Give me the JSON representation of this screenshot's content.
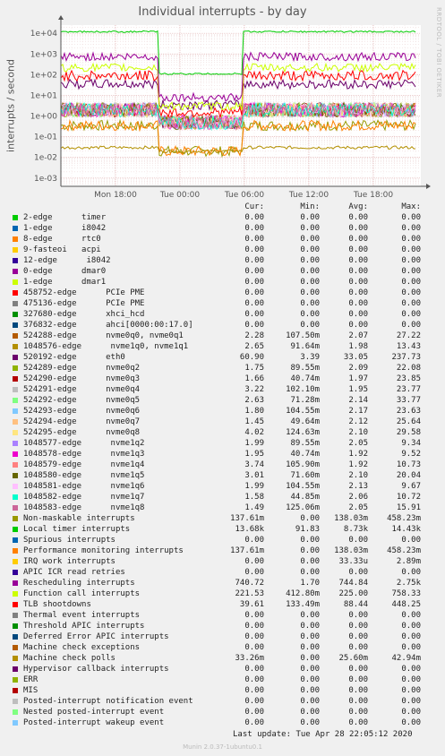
{
  "header": {
    "side_text": "RRDTOOL / TOBI OETIKER"
  },
  "footer": {
    "last_update": "Last update:  Tue Apr 28 22:05:12 2020",
    "munin_version": "Munin 2.0.37-1ubuntu0.1"
  },
  "legend_headers": {
    "cur": "Cur:",
    "min": "Min:",
    "avg": "Avg:",
    "max": "Max:"
  },
  "chart_data": {
    "type": "line",
    "title": "Individual interrupts - by day",
    "ylabel": "interrupts / second",
    "yscale": "log",
    "ylim": [
      0.0004,
      25000
    ],
    "y_ticks": [
      "1e-03",
      "1e-02",
      "1e-01",
      "1e+00",
      "1e+01",
      "1e+02",
      "1e+03",
      "1e+04"
    ],
    "x_ticks": [
      "Mon 18:00",
      "Tue 00:00",
      "Tue 06:00",
      "Tue 12:00",
      "Tue 18:00"
    ],
    "grid": true,
    "legend_position": "bottom",
    "series": [
      {
        "name": "2-edge      timer",
        "color": "#00cc00",
        "cur": "0.00",
        "min": "0.00",
        "avg": "0.00",
        "max": "0.00"
      },
      {
        "name": "1-edge      i8042",
        "color": "#0066b3",
        "cur": "0.00",
        "min": "0.00",
        "avg": "0.00",
        "max": "0.00"
      },
      {
        "name": "8-edge      rtc0",
        "color": "#ff8000",
        "cur": "0.00",
        "min": "0.00",
        "avg": "0.00",
        "max": "0.00"
      },
      {
        "name": "9-fasteoi   acpi",
        "color": "#ffcc00",
        "cur": "0.00",
        "min": "0.00",
        "avg": "0.00",
        "max": "0.00"
      },
      {
        "name": "12-edge      i8042",
        "color": "#330099",
        "cur": "0.00",
        "min": "0.00",
        "avg": "0.00",
        "max": "0.00"
      },
      {
        "name": "0-edge      dmar0",
        "color": "#990099",
        "cur": "0.00",
        "min": "0.00",
        "avg": "0.00",
        "max": "0.00"
      },
      {
        "name": "1-edge      dmar1",
        "color": "#ccff00",
        "cur": "0.00",
        "min": "0.00",
        "avg": "0.00",
        "max": "0.00"
      },
      {
        "name": "458752-edge      PCIe PME",
        "color": "#ff0000",
        "cur": "0.00",
        "min": "0.00",
        "avg": "0.00",
        "max": "0.00"
      },
      {
        "name": "475136-edge      PCIe PME",
        "color": "#808080",
        "cur": "0.00",
        "min": "0.00",
        "avg": "0.00",
        "max": "0.00"
      },
      {
        "name": "327680-edge      xhci_hcd",
        "color": "#008f00",
        "cur": "0.00",
        "min": "0.00",
        "avg": "0.00",
        "max": "0.00"
      },
      {
        "name": "376832-edge      ahci[0000:00:17.0]",
        "color": "#00487d",
        "cur": "0.00",
        "min": "0.00",
        "avg": "0.00",
        "max": "0.00"
      },
      {
        "name": "524288-edge      nvme0q0, nvme0q1",
        "color": "#b35a00",
        "cur": "2.28",
        "min": "107.50m",
        "avg": "2.07",
        "max": "27.22"
      },
      {
        "name": "1048576-edge      nvme1q0, nvme1q1",
        "color": "#b38f00",
        "cur": "2.65",
        "min": "91.64m",
        "avg": "1.98",
        "max": "13.43"
      },
      {
        "name": "520192-edge      eth0",
        "color": "#6b006b",
        "cur": "60.90",
        "min": "3.39",
        "avg": "33.05",
        "max": "237.73"
      },
      {
        "name": "524289-edge      nvme0q2",
        "color": "#8fb300",
        "cur": "1.75",
        "min": "89.55m",
        "avg": "2.09",
        "max": "22.08"
      },
      {
        "name": "524290-edge      nvme0q3",
        "color": "#b30000",
        "cur": "1.66",
        "min": "40.74m",
        "avg": "1.97",
        "max": "23.85"
      },
      {
        "name": "524291-edge      nvme0q4",
        "color": "#bebebe",
        "cur": "3.22",
        "min": "102.10m",
        "avg": "1.95",
        "max": "23.77"
      },
      {
        "name": "524292-edge      nvme0q5",
        "color": "#80ff80",
        "cur": "2.63",
        "min": "71.28m",
        "avg": "2.14",
        "max": "33.77"
      },
      {
        "name": "524293-edge      nvme0q6",
        "color": "#80c9ff",
        "cur": "1.80",
        "min": "104.55m",
        "avg": "2.17",
        "max": "23.63"
      },
      {
        "name": "524294-edge      nvme0q7",
        "color": "#ffc080",
        "cur": "1.45",
        "min": "49.64m",
        "avg": "2.12",
        "max": "25.64"
      },
      {
        "name": "524295-edge      nvme0q8",
        "color": "#ffe680",
        "cur": "4.02",
        "min": "124.63m",
        "avg": "2.10",
        "max": "29.58"
      },
      {
        "name": "1048577-edge      nvme1q2",
        "color": "#aa80ff",
        "cur": "1.99",
        "min": "89.55m",
        "avg": "2.05",
        "max": "9.34"
      },
      {
        "name": "1048578-edge      nvme1q3",
        "color": "#ee00cc",
        "cur": "1.95",
        "min": "40.74m",
        "avg": "1.92",
        "max": "9.52"
      },
      {
        "name": "1048579-edge      nvme1q4",
        "color": "#ff8080",
        "cur": "3.74",
        "min": "105.90m",
        "avg": "1.92",
        "max": "10.73"
      },
      {
        "name": "1048580-edge      nvme1q5",
        "color": "#666600",
        "cur": "3.01",
        "min": "71.60m",
        "avg": "2.10",
        "max": "20.04"
      },
      {
        "name": "1048581-edge      nvme1q6",
        "color": "#ffbfff",
        "cur": "1.99",
        "min": "104.55m",
        "avg": "2.13",
        "max": "9.67"
      },
      {
        "name": "1048582-edge      nvme1q7",
        "color": "#00ffcc",
        "cur": "1.58",
        "min": "44.85m",
        "avg": "2.06",
        "max": "10.72"
      },
      {
        "name": "1048583-edge      nvme1q8",
        "color": "#cc6699",
        "cur": "1.49",
        "min": "125.06m",
        "avg": "2.05",
        "max": "15.91"
      },
      {
        "name": "Non-maskable interrupts",
        "color": "#999900",
        "cur": "137.61m",
        "min": "0.00",
        "avg": "138.03m",
        "max": "458.23m"
      },
      {
        "name": "Local timer interrupts",
        "color": "#00cc00",
        "cur": "13.68k",
        "min": "91.83",
        "avg": "8.73k",
        "max": "14.43k"
      },
      {
        "name": "Spurious interrupts",
        "color": "#0066b3",
        "cur": "0.00",
        "min": "0.00",
        "avg": "0.00",
        "max": "0.00"
      },
      {
        "name": "Performance monitoring interrupts",
        "color": "#ff8000",
        "cur": "137.61m",
        "min": "0.00",
        "avg": "138.03m",
        "max": "458.23m"
      },
      {
        "name": "IRQ work interrupts",
        "color": "#ffcc00",
        "cur": "0.00",
        "min": "0.00",
        "avg": "33.33u",
        "max": "2.89m"
      },
      {
        "name": "APIC ICR read retries",
        "color": "#330099",
        "cur": "0.00",
        "min": "0.00",
        "avg": "0.00",
        "max": "0.00"
      },
      {
        "name": "Rescheduling interrupts",
        "color": "#990099",
        "cur": "740.72",
        "min": "1.70",
        "avg": "744.84",
        "max": "2.75k"
      },
      {
        "name": "Function call interrupts",
        "color": "#ccff00",
        "cur": "221.53",
        "min": "412.80m",
        "avg": "225.00",
        "max": "758.33"
      },
      {
        "name": "TLB shootdowns",
        "color": "#ff0000",
        "cur": "39.61",
        "min": "133.49m",
        "avg": "88.44",
        "max": "448.25"
      },
      {
        "name": "Thermal event interrupts",
        "color": "#808080",
        "cur": "0.00",
        "min": "0.00",
        "avg": "0.00",
        "max": "0.00"
      },
      {
        "name": "Threshold APIC interrupts",
        "color": "#008f00",
        "cur": "0.00",
        "min": "0.00",
        "avg": "0.00",
        "max": "0.00"
      },
      {
        "name": "Deferred Error APIC interrupts",
        "color": "#00487d",
        "cur": "0.00",
        "min": "0.00",
        "avg": "0.00",
        "max": "0.00"
      },
      {
        "name": "Machine check exceptions",
        "color": "#b35a00",
        "cur": "0.00",
        "min": "0.00",
        "avg": "0.00",
        "max": "0.00"
      },
      {
        "name": "Machine check polls",
        "color": "#b38f00",
        "cur": "33.26m",
        "min": "0.00",
        "avg": "25.60m",
        "max": "42.94m"
      },
      {
        "name": "Hypervisor callback interrupts",
        "color": "#6b006b",
        "cur": "0.00",
        "min": "0.00",
        "avg": "0.00",
        "max": "0.00"
      },
      {
        "name": "ERR",
        "color": "#8fb300",
        "cur": "0.00",
        "min": "0.00",
        "avg": "0.00",
        "max": "0.00"
      },
      {
        "name": "MIS",
        "color": "#b30000",
        "cur": "0.00",
        "min": "0.00",
        "avg": "0.00",
        "max": "0.00"
      },
      {
        "name": "Posted-interrupt notification event",
        "color": "#bebebe",
        "cur": "0.00",
        "min": "0.00",
        "avg": "0.00",
        "max": "0.00"
      },
      {
        "name": "Nested posted-interrupt event",
        "color": "#80ff80",
        "cur": "0.00",
        "min": "0.00",
        "avg": "0.00",
        "max": "0.00"
      },
      {
        "name": "Posted-interrupt wakeup event",
        "color": "#80c9ff",
        "cur": "0.00",
        "min": "0.00",
        "avg": "0.00",
        "max": "0.00"
      }
    ]
  }
}
